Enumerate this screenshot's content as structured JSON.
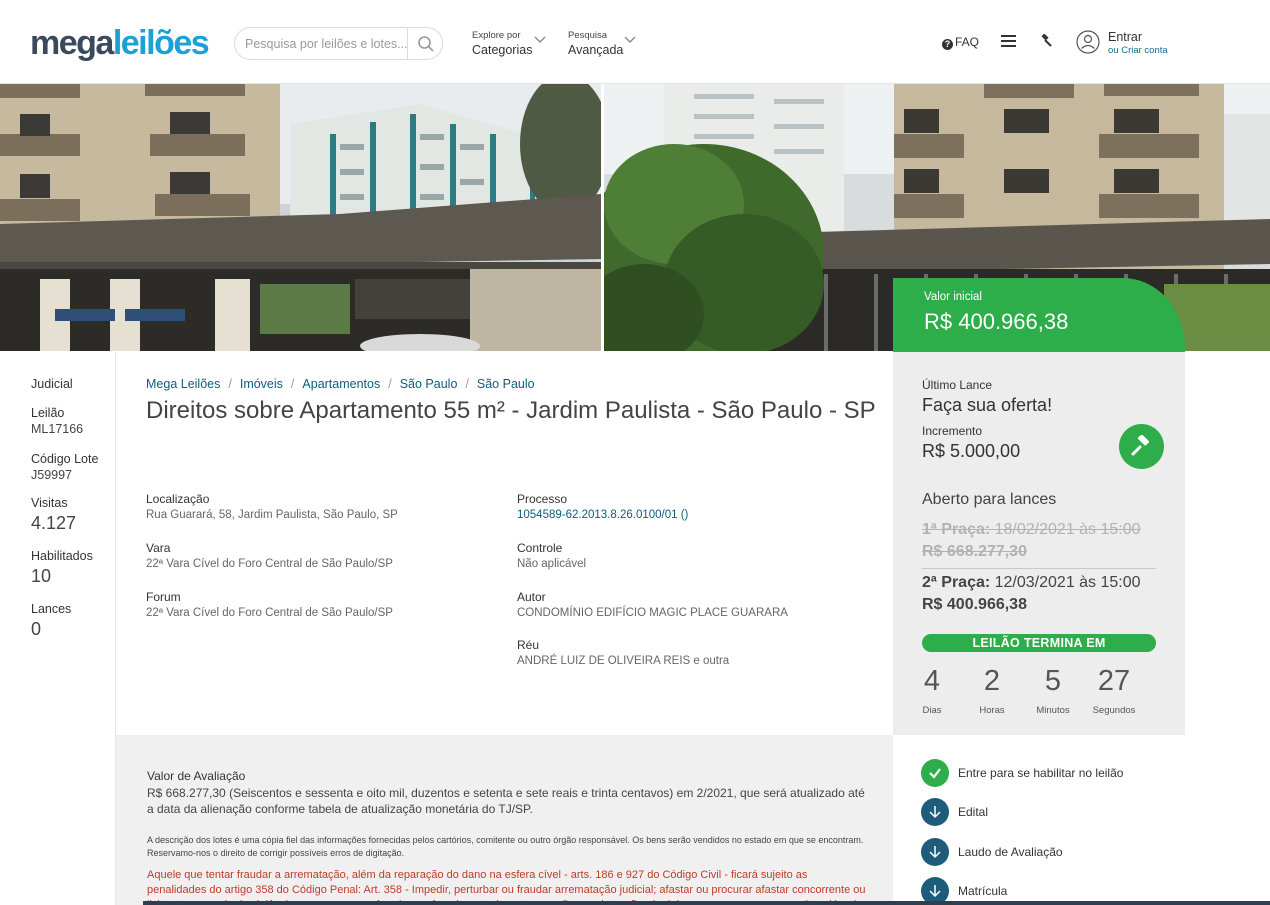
{
  "header": {
    "logo_part1": "mega",
    "logo_part2": "leilões",
    "search_placeholder": "Pesquisa por leilões e lotes...",
    "explore_small": "Explore por",
    "explore_big": "Categorias",
    "advanced_small": "Pesquisa",
    "advanced_big": "Avançada",
    "faq": "FAQ",
    "login": "Entrar",
    "signup": "ou Criar conta"
  },
  "price": {
    "label": "Valor inicial",
    "value": "R$ 400.966,38"
  },
  "left": {
    "type": "Judicial",
    "auction_label": "Leilão",
    "auction_value": "ML17166",
    "lot_label": "Código Lote",
    "lot_value": "J59997",
    "visits_label": "Visitas",
    "visits_value": "4.127",
    "enabled_label": "Habilitados",
    "enabled_value": "10",
    "bids_label": "Lances",
    "bids_value": "0"
  },
  "breadcrumb": [
    "Mega Leilões",
    "Imóveis",
    "Apartamentos",
    "São Paulo",
    "São Paulo"
  ],
  "title": "Direitos sobre Apartamento 55 m² - Jardim Paulista - São Paulo - SP",
  "details": {
    "location_label": "Localização",
    "location_value": "Rua Guarará, 58, Jardim Paulista, São Paulo, SP",
    "court_label": "Vara",
    "court_value": "22ª Vara Cível do Foro Central de São Paulo/SP",
    "forum_label": "Forum",
    "forum_value": "22ª Vara Cível do Foro Central de São Paulo/SP",
    "process_label": "Processo",
    "process_value": "1054589-62.2013.8.26.0100/01 ()",
    "control_label": "Controle",
    "control_value": "Não aplicável",
    "author_label": "Autor",
    "author_value": "CONDOMÍNIO EDIFÍCIO MAGIC PLACE GUARARA",
    "defendant_label": "Réu",
    "defendant_value": "ANDRÉ LUIZ DE OLIVEIRA REIS e outra"
  },
  "bid": {
    "last_label": "Último Lance",
    "last_value": "Faça sua oferta!",
    "inc_label": "Incremento",
    "inc_value": "R$ 5.000,00",
    "status": "Aberto para lances",
    "p1_label": "1ª Praça:",
    "p1_date": " 18/02/2021 às 15:00",
    "p1_value": "R$ 668.277,30",
    "p2_label": "2ª Praça:",
    "p2_date": " 12/03/2021 às 15:00",
    "p2_value": "R$ 400.966,38",
    "ends": "LEILÃO TERMINA EM",
    "countdown": {
      "days": "4",
      "days_label": "Dias",
      "hours": "2",
      "hours_label": "Horas",
      "minutes": "5",
      "minutes_label": "Minutos",
      "seconds": "27",
      "seconds_label": "Segundos"
    }
  },
  "description": {
    "valuation_label": "Valor de Avaliação",
    "valuation_text": "R$ 668.277,30 (Seiscentos e sessenta e oito mil, duzentos e setenta e sete reais e trinta centavos) em 2/2021, que será atualizado até a data da alienação conforme tabela de atualização monetária do TJ/SP.",
    "disclaimer": "A descrição dos lotes é uma cópia fiel das informações fornecidas pelos cartórios, comitente ou outro órgão responsável. Os bens serão vendidos no estado em que se encontram. Reservamo-nos o direito de corrigir possíveis erros de digitação.",
    "warning": "Aquele que tentar fraudar a arrematação, além da reparação do dano na esfera cível - arts. 186 e 927 do Código Civil - ficará sujeito as penalidades do artigo 358 do Código Penal: Art. 358 - Impedir, perturbar ou fraudar arrematação judicial; afastar ou procurar afastar concorrente ou licitante, por meio de violência, grave ameaça, fraude ou oferecimento de vantagem: Pena - detenção, de dois meses a um ano, ou multa, além da pena correspondente à violência."
  },
  "actions": {
    "enable": "Entre para se habilitar no leilão",
    "edital": "Edital",
    "laudo": "Laudo de Avaliação",
    "matricula": "Matrícula"
  },
  "colors": {
    "green": "#2eae4a",
    "link": "#0e5e7a",
    "logo_blue": "#1ba1d6",
    "icon_blue": "#1e5c7a"
  }
}
